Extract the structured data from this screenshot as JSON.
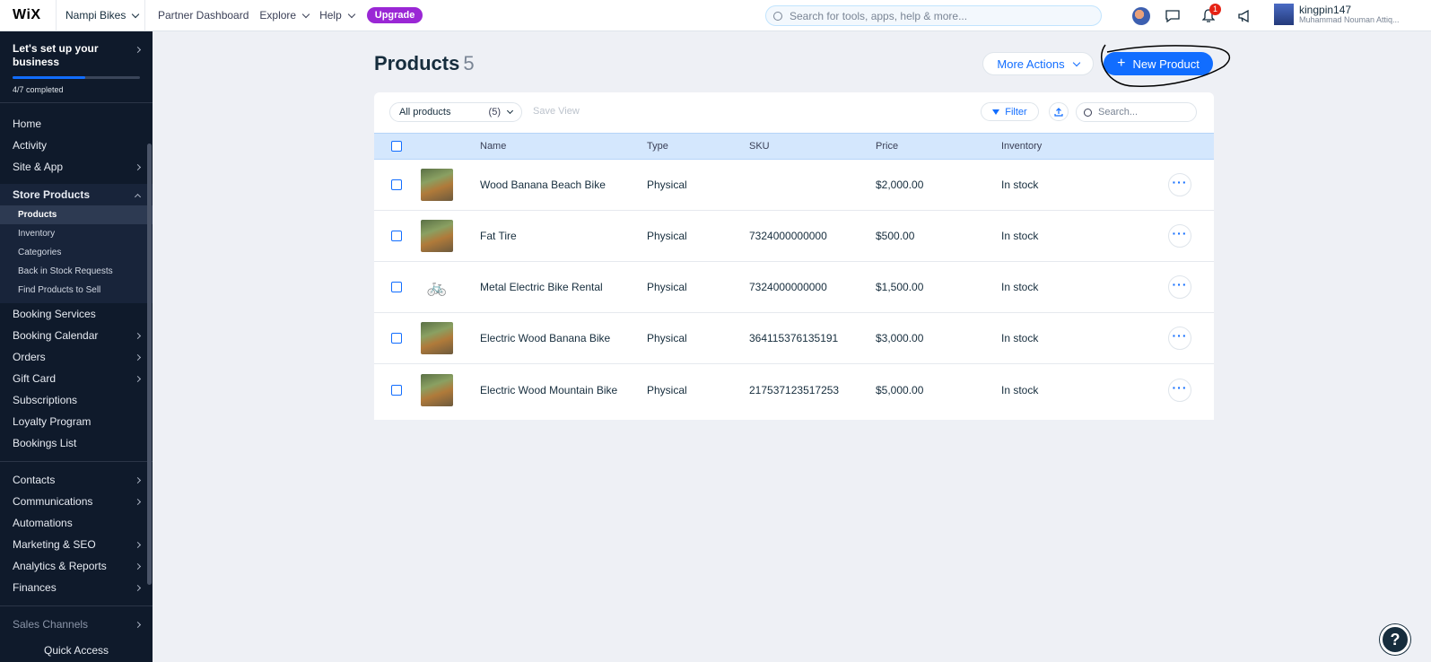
{
  "topbar": {
    "logo": "WiX",
    "site_name": "Nampi Bikes",
    "nav": [
      "Partner Dashboard",
      "Explore",
      "Help"
    ],
    "upgrade": "Upgrade",
    "search_placeholder": "Search for tools, apps, help & more...",
    "notification_count": "1",
    "user_name": "kingpin147",
    "user_full": "Muhammad Nouman Attiq..."
  },
  "sidebar": {
    "setup_title": "Let's set up your business",
    "setup_progress": "4/7 completed",
    "progress_fraction": 0.57,
    "items_top": [
      {
        "label": "Home",
        "arrow": false
      },
      {
        "label": "Activity",
        "arrow": false
      },
      {
        "label": "Site & App",
        "arrow": true
      }
    ],
    "store_group": {
      "label": "Store Products",
      "children": [
        "Products",
        "Inventory",
        "Categories",
        "Back in Stock Requests",
        "Find Products to Sell"
      ]
    },
    "items_mid": [
      {
        "label": "Booking Services",
        "arrow": false
      },
      {
        "label": "Booking Calendar",
        "arrow": true
      },
      {
        "label": "Orders",
        "arrow": true
      },
      {
        "label": "Gift Card",
        "arrow": true
      },
      {
        "label": "Subscriptions",
        "arrow": false
      },
      {
        "label": "Loyalty Program",
        "arrow": false
      },
      {
        "label": "Bookings List",
        "arrow": false
      }
    ],
    "items_bottom": [
      {
        "label": "Contacts",
        "arrow": true
      },
      {
        "label": "Communications",
        "arrow": true
      },
      {
        "label": "Automations",
        "arrow": false
      },
      {
        "label": "Marketing & SEO",
        "arrow": true
      },
      {
        "label": "Analytics & Reports",
        "arrow": true
      },
      {
        "label": "Finances",
        "arrow": true
      }
    ],
    "sales_channels": "Sales Channels",
    "quick_access": "Quick Access"
  },
  "main": {
    "title": "Products",
    "count": "5",
    "more_actions": "More Actions",
    "new_product": "New Product",
    "view_label": "All products",
    "view_count": "(5)",
    "save_view": "Save View",
    "filter": "Filter",
    "search_placeholder": "Search...",
    "columns": [
      "Name",
      "Type",
      "SKU",
      "Price",
      "Inventory"
    ],
    "rows": [
      {
        "name": "Wood Banana Beach Bike",
        "type": "Physical",
        "sku": "",
        "price": "$2,000.00",
        "inventory": "In stock",
        "thumb": "photo"
      },
      {
        "name": "Fat Tire",
        "type": "Physical",
        "sku": "7324000000000",
        "price": "$500.00",
        "inventory": "In stock",
        "thumb": "photo"
      },
      {
        "name": "Metal Electric Bike Rental",
        "type": "Physical",
        "sku": "7324000000000",
        "price": "$1,500.00",
        "inventory": "In stock",
        "thumb": "bike-icon"
      },
      {
        "name": "Electric Wood Banana Bike",
        "type": "Physical",
        "sku": "364115376135191",
        "price": "$3,000.00",
        "inventory": "In stock",
        "thumb": "photo"
      },
      {
        "name": "Electric Wood Mountain Bike",
        "type": "Physical",
        "sku": "217537123517253",
        "price": "$5,000.00",
        "inventory": "In stock",
        "thumb": "photo"
      }
    ]
  },
  "help_fab": "?",
  "colors": {
    "accent": "#116dff",
    "sidebar": "#0f1a2b",
    "upgrade": "#9a27d5"
  }
}
